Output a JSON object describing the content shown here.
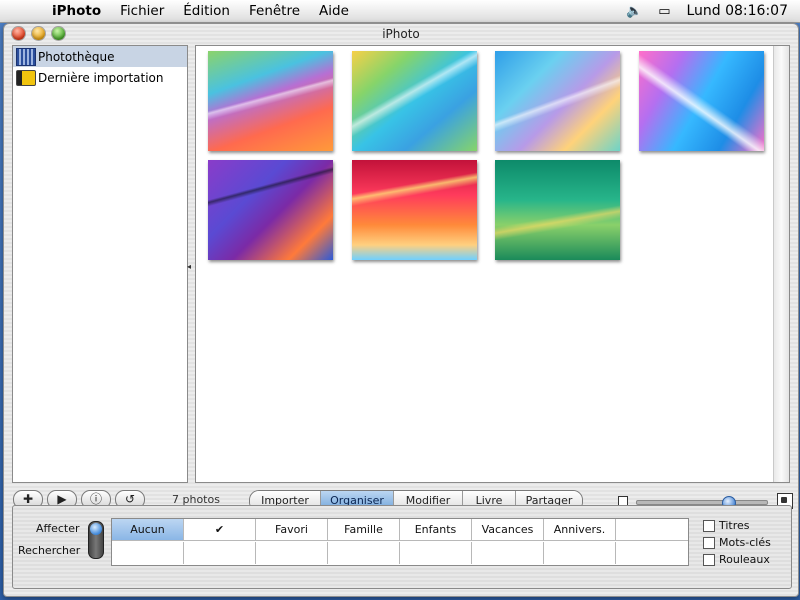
{
  "menubar": {
    "items": [
      "iPhoto",
      "Fichier",
      "Édition",
      "Fenêtre",
      "Aide"
    ],
    "clock": "Lund 08:16:07"
  },
  "window": {
    "title": "iPhoto"
  },
  "sidebar": {
    "items": [
      {
        "label": "Photothèque",
        "icon": "library-icon",
        "selected": true
      },
      {
        "label": "Dernière importation",
        "icon": "film-roll-icon",
        "selected": false
      }
    ]
  },
  "photos": {
    "count": 7
  },
  "toolbar": {
    "add_icon": "plus-icon",
    "slideshow_icon": "play-icon",
    "info_icon": "info-icon",
    "rotate_icon": "rotate-icon",
    "photo_count_label": "7 photos",
    "modes": [
      {
        "label": "Importer",
        "active": false
      },
      {
        "label": "Organiser",
        "active": true
      },
      {
        "label": "Modifier",
        "active": false
      },
      {
        "label": "Livre",
        "active": false
      },
      {
        "label": "Partager",
        "active": false
      }
    ],
    "zoom_fraction": 0.72
  },
  "keywords": {
    "assign_label": "Affecter",
    "search_label": "Rechercher",
    "cells": [
      "Aucun",
      "✔",
      "Favori",
      "Famille",
      "Enfants",
      "Vacances",
      "Annivers.",
      ""
    ],
    "checkboxes": [
      {
        "label": "Titres",
        "checked": false
      },
      {
        "label": "Mots-clés",
        "checked": false
      },
      {
        "label": "Rouleaux",
        "checked": false
      }
    ]
  }
}
